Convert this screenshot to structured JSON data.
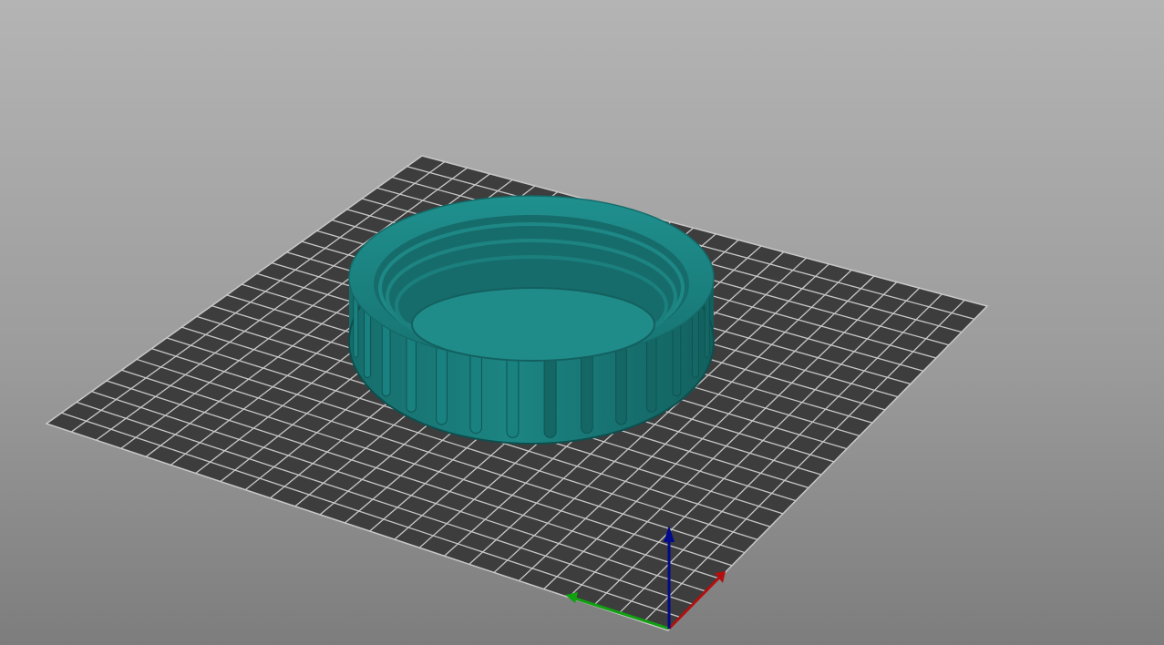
{
  "viewport": {
    "bed": {
      "corners_note": "",
      "grid_divisions": 25,
      "tile_color": "#3d3d3d",
      "line_color": "#c8c8c8"
    },
    "model": {
      "type": "threaded screw cap",
      "color": "#1f8a88",
      "grip_ribs": 30
    },
    "axes": {
      "x_color": "#b01010",
      "y_color": "#10a010",
      "z_color": "#000a8a"
    }
  }
}
